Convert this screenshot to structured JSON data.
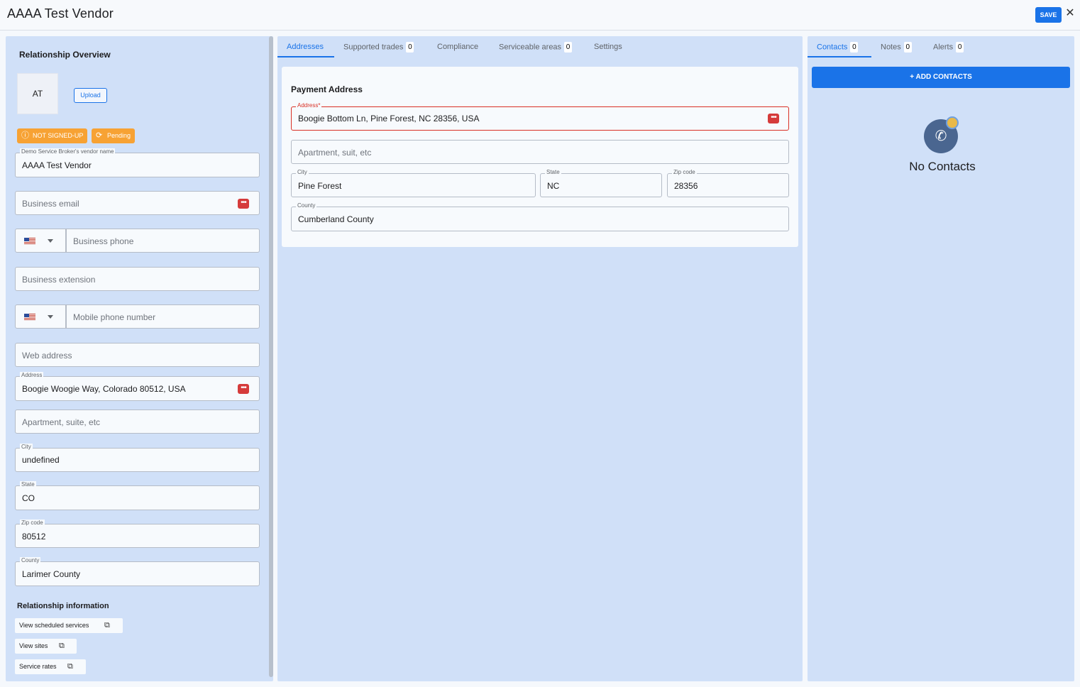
{
  "header": {
    "title": "AAAA Test Vendor",
    "save_label": "SAVE",
    "close_glyph": "✕"
  },
  "left": {
    "section_title": "Relationship Overview",
    "avatar_initials": "AT",
    "upload_label": "Upload",
    "badges": [
      {
        "label": "NOT SIGNED-UP",
        "icon": "alert-circle-icon",
        "glyph": "ⓘ"
      },
      {
        "label": "Pending",
        "icon": "sync-icon",
        "glyph": "⟳"
      }
    ],
    "vendor_name": {
      "label": "Demo Service Broker's vendor name",
      "value": "AAAA Test Vendor"
    },
    "business_email": {
      "placeholder": "Business email"
    },
    "business_phone": {
      "placeholder": "Business phone"
    },
    "business_extension": {
      "placeholder": "Business extension"
    },
    "mobile_phone": {
      "placeholder": "Mobile phone number"
    },
    "web_address": {
      "placeholder": "Web address"
    },
    "address": {
      "label": "Address",
      "value": "Boogie Woogie Way, Colorado 80512, USA"
    },
    "apartment": {
      "placeholder": "Apartment, suite, etc"
    },
    "city": {
      "label": "City",
      "value": "undefined"
    },
    "state": {
      "label": "State",
      "value": "CO"
    },
    "zip": {
      "label": "Zip code",
      "value": "80512"
    },
    "county": {
      "label": "County",
      "value": "Larimer County"
    },
    "relationship_title": "Relationship information",
    "links": [
      "View scheduled services",
      "View sites",
      "Service rates"
    ]
  },
  "middle": {
    "tabs": [
      {
        "label": "Addresses",
        "count": null,
        "active": true
      },
      {
        "label": "Supported trades",
        "count": "0",
        "active": false
      },
      {
        "label": "Compliance",
        "count": null,
        "active": false
      },
      {
        "label": "Serviceable areas",
        "count": "0",
        "active": false
      },
      {
        "label": "Settings",
        "count": null,
        "active": false
      }
    ],
    "payment_title": "Payment Address",
    "address": {
      "label": "Address*",
      "value": "Boogie Bottom Ln, Pine Forest, NC 28356, USA"
    },
    "apartment": {
      "placeholder": "Apartment, suit, etc"
    },
    "city": {
      "label": "City",
      "value": "Pine Forest"
    },
    "state": {
      "label": "State",
      "value": "NC"
    },
    "zip": {
      "label": "Zip code",
      "value": "28356"
    },
    "county": {
      "label": "County",
      "value": "Cumberland County"
    }
  },
  "right": {
    "tabs": [
      {
        "label": "Contacts",
        "count": "0",
        "active": true
      },
      {
        "label": "Notes",
        "count": "0",
        "active": false
      },
      {
        "label": "Alerts",
        "count": "0",
        "active": false
      }
    ],
    "add_contacts_label": "+ ADD CONTACTS",
    "empty_text": "No Contacts",
    "empty_icon": "phone-icon"
  },
  "colors": {
    "accent": "#1a73e8",
    "panel": "#d0e0f8",
    "badge": "#f7a234",
    "error": "#d93025"
  }
}
